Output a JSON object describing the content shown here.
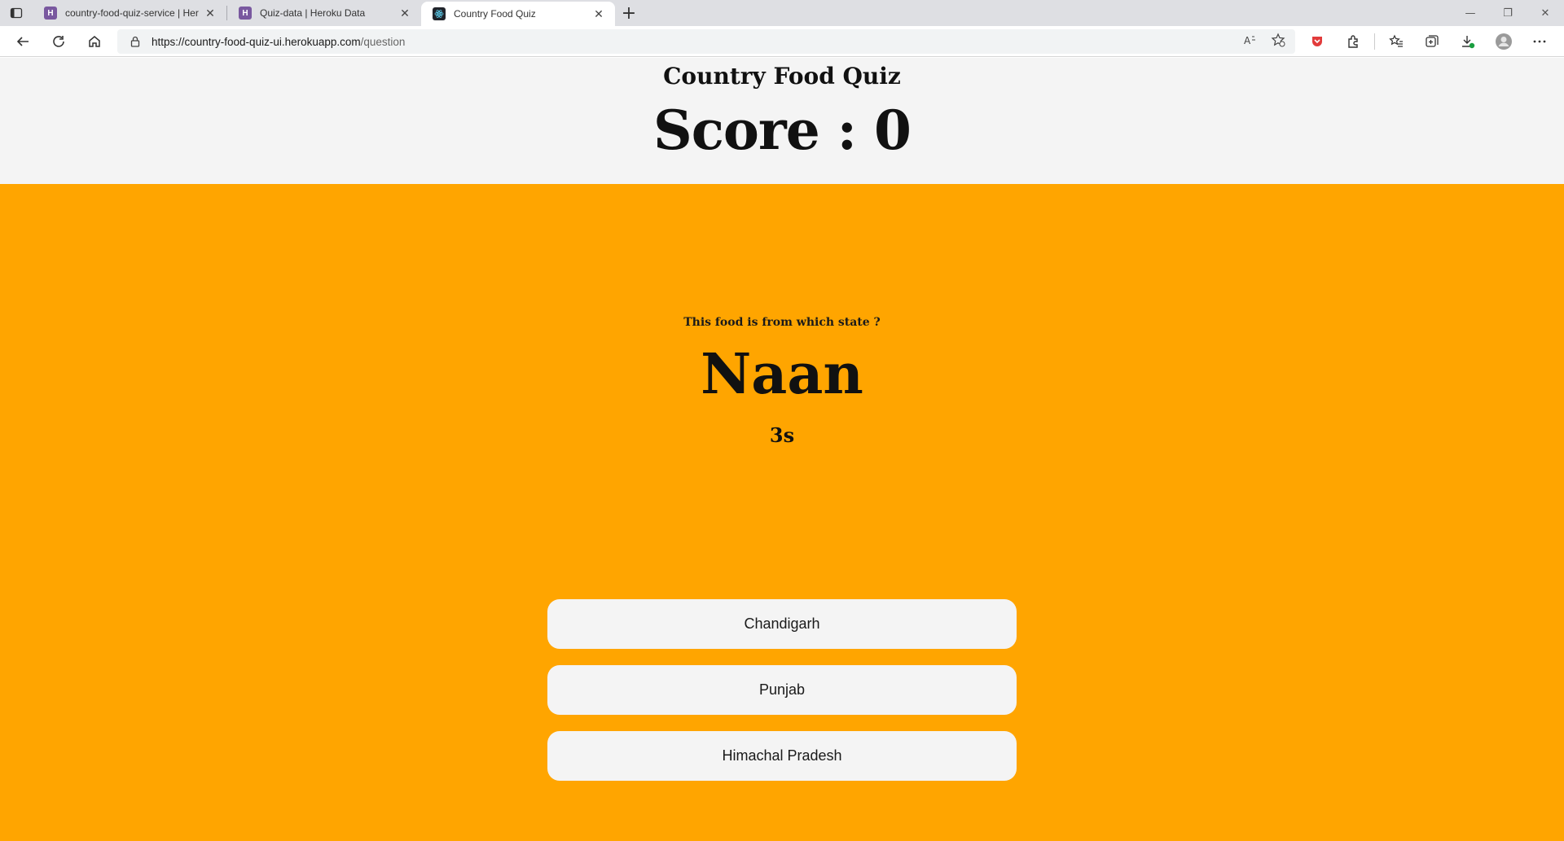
{
  "browser": {
    "tabs": [
      {
        "title": "country-food-quiz-service | Hero",
        "icon": "heroku-icon",
        "active": false
      },
      {
        "title": "Quiz-data | Heroku Data",
        "icon": "heroku-icon",
        "active": false
      },
      {
        "title": "Country Food Quiz",
        "icon": "react-icon",
        "active": true
      }
    ],
    "url": {
      "main": "https://country-food-quiz-ui.herokuapp.com",
      "path": "/question"
    },
    "colors": {
      "heroku": "#79589f",
      "react": "#20232a"
    }
  },
  "header": {
    "title": "Country Food Quiz",
    "score_label": "Score : 0"
  },
  "quiz": {
    "question": "This food is from which state ?",
    "food": "Naan",
    "timer": "3s",
    "options": [
      {
        "label": "Chandigarh"
      },
      {
        "label": "Punjab"
      },
      {
        "label": "Himachal Pradesh"
      }
    ],
    "background": "#ffa500"
  }
}
